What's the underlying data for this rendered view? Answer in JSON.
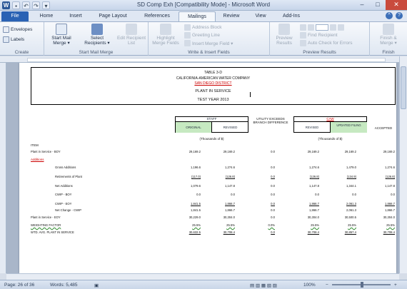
{
  "window": {
    "title": "SD Comp Exh [Compatibility Mode] - Microsoft Word",
    "minimize": "–",
    "maximize": "□",
    "close": "✕"
  },
  "tabs": [
    {
      "label": "File"
    },
    {
      "label": "Home"
    },
    {
      "label": "Insert"
    },
    {
      "label": "Page Layout"
    },
    {
      "label": "References"
    },
    {
      "label": "Mailings"
    },
    {
      "label": "Review"
    },
    {
      "label": "View"
    },
    {
      "label": "Add-Ins"
    }
  ],
  "ribbon": {
    "create": {
      "label": "Create",
      "envelopes": "Envelopes",
      "labels": "Labels"
    },
    "start_mail_merge": {
      "label": "Start Mail Merge",
      "start": "Start Mail Merge ▾",
      "select": "Select Recipients ▾",
      "edit": "Edit Recipient List"
    },
    "write_insert": {
      "label": "Write & Insert Fields",
      "highlight": "Highlight Merge Fields",
      "address": "Address Block",
      "greeting": "Greeting Line",
      "insert_field": "Insert Merge Field ▾"
    },
    "preview": {
      "label": "Preview Results",
      "preview": "Preview Results",
      "find": "Find Recipient",
      "auto_check": "Auto Check for Errors"
    },
    "finish": {
      "label": "Finish",
      "finish_merge": "Finish & Merge ▾"
    }
  },
  "document": {
    "header": {
      "table": "TABLE 3-D",
      "company": "CALIFORNIA-AMERICAN WATER COMPANY",
      "district": "SAN DIEGO DISTRICT",
      "subject": "PLANT IN SERVICE",
      "year": "TEST YEAR 2013"
    },
    "columns": {
      "staff": "STAFF",
      "original": "ORIGINAL",
      "revised": "REVISED",
      "utility": "UTILITY EXCEEDS BRANCH DIFFERENCE",
      "caw": "CAW",
      "caw_revised": "REVISED",
      "updated": "UPDATED FILING",
      "accepted": "ACCEPTED",
      "units_staff": "(Thousands of $)",
      "units_caw": "(Thousands of $)"
    },
    "item_label": "ITEM",
    "additions_label": "Additions",
    "rows": [
      {
        "label": "Plant in Service - BOY",
        "indent": 0,
        "vals": [
          "29,169.2",
          "29,169.2",
          "0.0",
          "29,169.2",
          "29,169.2",
          "29,169.2"
        ]
      },
      {
        "label": "Gross Additions",
        "indent": 1,
        "vals": [
          "1,196.6",
          "1,274.6",
          "0.0",
          "1,274.6",
          "1,479.0",
          "1,274.6"
        ]
      },
      {
        "label": "Retirements of Plant",
        "indent": 1,
        "vals": [
          "(117.0)",
          "(126.8)",
          "0.0",
          "(126.8)",
          "(134.9)",
          "(126.8)"
        ],
        "ul": true
      },
      {
        "label": "Net Additions",
        "indent": 1,
        "vals": [
          "1,079.6",
          "1,147.8",
          "0.0",
          "1,147.8",
          "1,344.1",
          "1,147.8"
        ]
      },
      {
        "label": "CWIP - BOY",
        "indent": 1,
        "vals": [
          "0.0",
          "0.0",
          "0.0",
          "0.0",
          "0.0",
          "0.0"
        ]
      },
      {
        "label": "CWIP - EOY",
        "indent": 1,
        "vals": [
          "1,841.5",
          "1,866.7",
          "0.0",
          "1,866.7",
          "2,061.3",
          "1,866.7"
        ],
        "ul": true
      },
      {
        "label": "Net Change - CWIP",
        "indent": 1,
        "vals": [
          "1,841.5",
          "1,866.7",
          "0.0",
          "1,866.7",
          "2,061.3",
          "1,866.7"
        ]
      },
      {
        "label": "Plant in Service - EOY",
        "indent": 0,
        "vals": [
          "30,229.0",
          "30,304.0",
          "0.0",
          "30,304.0",
          "30,500.5",
          "30,304.0"
        ]
      },
      {
        "label": "WEIGHTING FACTOR",
        "indent": 0,
        "vals": [
          "25.5%",
          "25.5%",
          "0.0%",
          "25.5%",
          "25.5%",
          "25.5%"
        ],
        "wavy": true
      },
      {
        "label": "WTD. AVG. PLANT IN SERVICE",
        "indent": 0,
        "vals": [
          "30,632.5",
          "30,708.4",
          "0.0",
          "30,708.4",
          "30,857.4",
          "30,708.4"
        ],
        "ul": true
      }
    ]
  },
  "status": {
    "page": "Page: 26 of 36",
    "words": "Words: 5,485",
    "zoom": "100%",
    "zoom_value": 1.0
  },
  "colors": {
    "file_tab": "#2a62b4",
    "highlight_green": "#c6e9c1",
    "caw_red": "#d00000",
    "close": "#c94b3d"
  }
}
